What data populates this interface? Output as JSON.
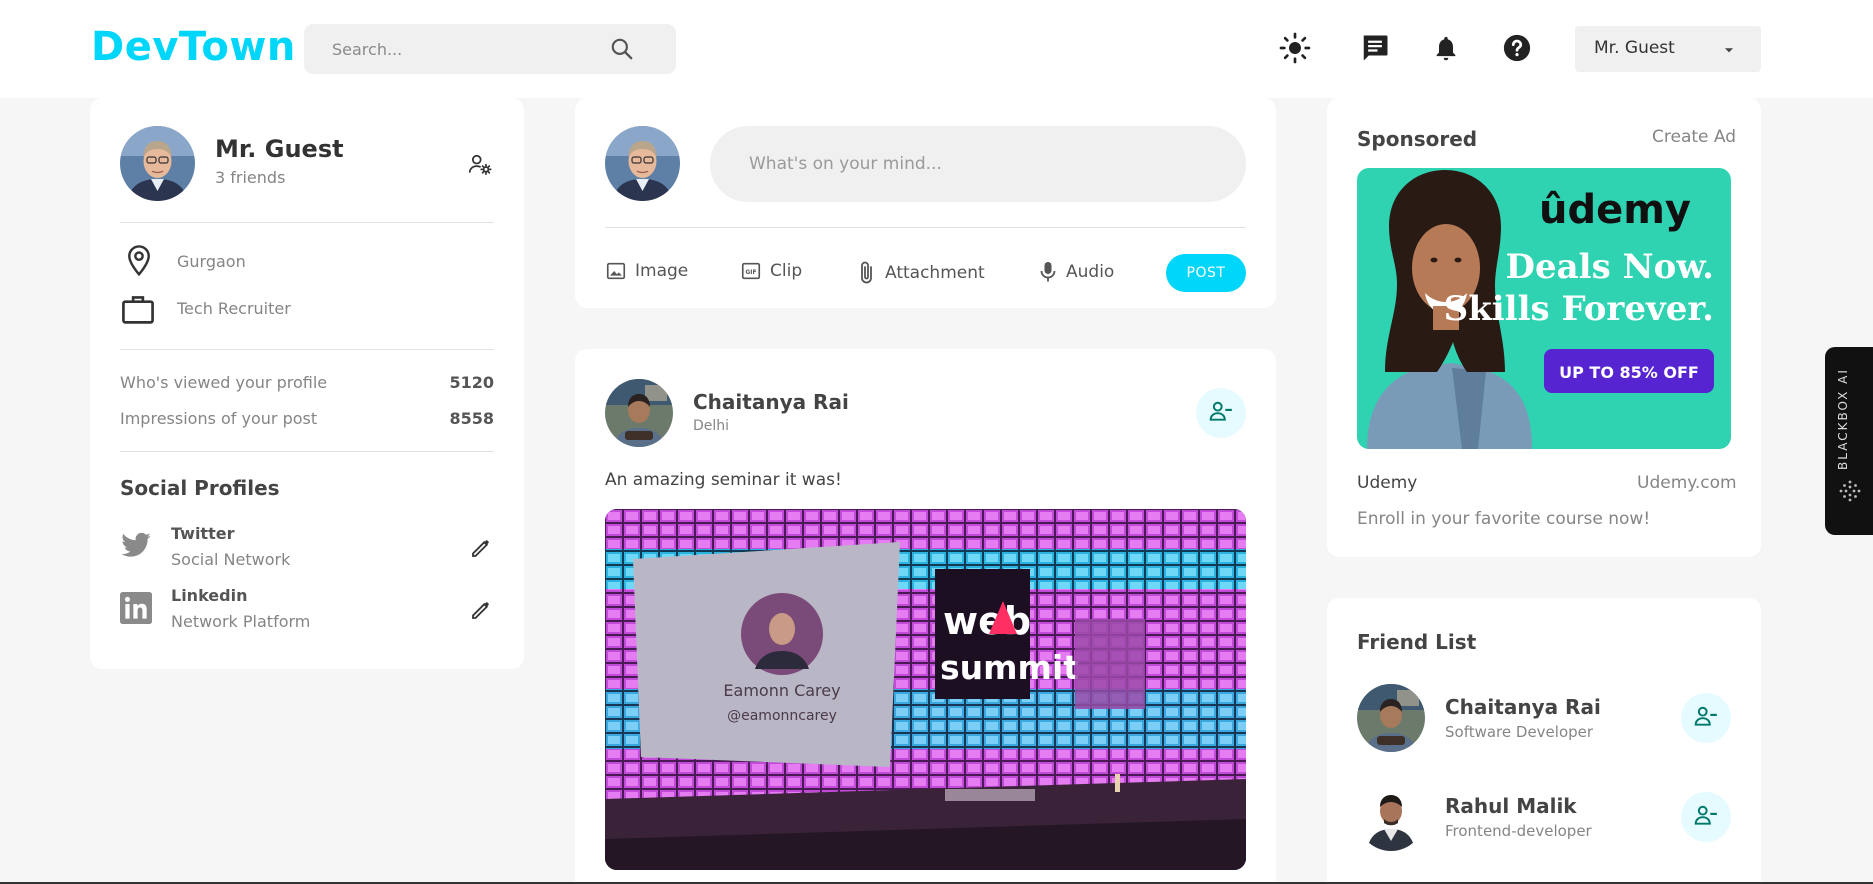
{
  "header": {
    "logo": "DevTown",
    "search_placeholder": "Search...",
    "user_select": "Mr. Guest"
  },
  "profile": {
    "name": "Mr. Guest",
    "friends": "3 friends",
    "location": "Gurgaon",
    "occupation": "Tech Recruiter",
    "stats": [
      {
        "label": "Who's viewed your profile",
        "value": "5120"
      },
      {
        "label": "Impressions of your post",
        "value": "8558"
      }
    ],
    "social_title": "Social Profiles",
    "socials": [
      {
        "name": "Twitter",
        "type": "Social Network"
      },
      {
        "name": "Linkedin",
        "type": "Network Platform"
      }
    ]
  },
  "composer": {
    "placeholder": "What's on your mind...",
    "tools": [
      {
        "label": "Image",
        "icon": "image-icon"
      },
      {
        "label": "Clip",
        "icon": "gif-icon"
      },
      {
        "label": "Attachment",
        "icon": "paperclip-icon"
      },
      {
        "label": "Audio",
        "icon": "microphone-icon"
      }
    ],
    "post_button": "POST"
  },
  "post": {
    "author": "Chaitanya Rai",
    "location": "Delhi",
    "text": "An amazing seminar it was!",
    "image_texts": {
      "brand_line1": "web",
      "brand_line2": "summit",
      "speaker": "Eamonn Carey",
      "handle": "@eamonncarey"
    }
  },
  "sponsored": {
    "title": "Sponsored",
    "create_ad": "Create Ad",
    "ad_texts": {
      "logo": "ûdemy",
      "headline1": "Deals Now.",
      "headline2": "Skills Forever.",
      "cta": "UP TO 85% OFF"
    },
    "brand": "Udemy",
    "url": "Udemy.com",
    "description": "Enroll in your favorite course now!"
  },
  "friend_list": {
    "title": "Friend List",
    "friends": [
      {
        "name": "Chaitanya Rai",
        "role": "Software Developer"
      },
      {
        "name": "Rahul Malik",
        "role": "Frontend-developer"
      }
    ]
  },
  "widget": {
    "label": "BLACKBOX AI"
  },
  "colors": {
    "accent": "#00d5fa",
    "background": "#f6f6f6",
    "udemy_purple": "#5624d0",
    "udemy_teal": "#2fd3b2"
  }
}
